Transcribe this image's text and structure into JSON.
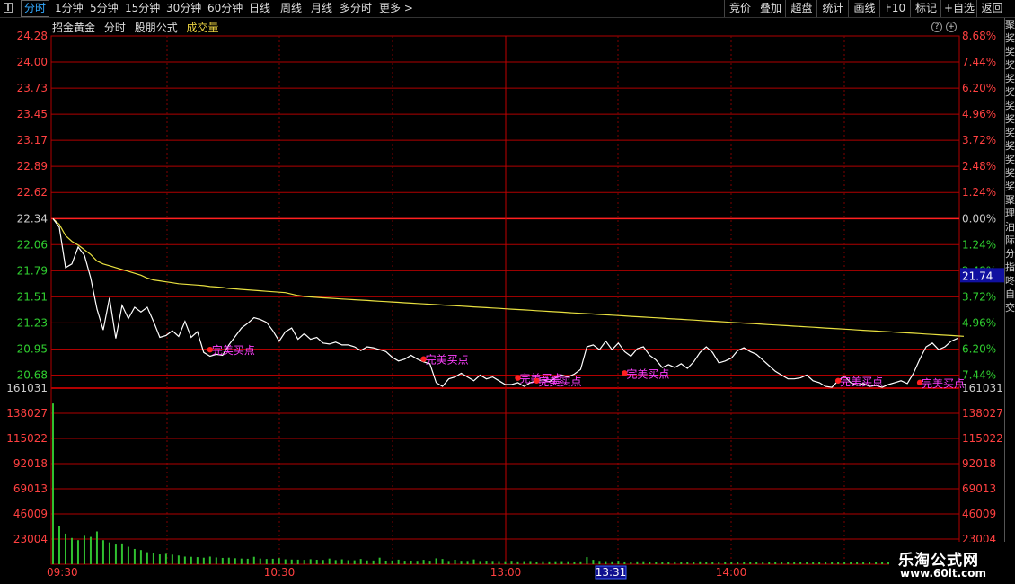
{
  "toolbar": {
    "periods": [
      "分时",
      "1分钟",
      "5分钟",
      "15分钟",
      "30分钟",
      "60分钟",
      "日线",
      "周线",
      "月线",
      "多分时",
      "更多"
    ],
    "active_index": 0,
    "right_buttons": [
      "竞价",
      "叠加",
      "超盘",
      "统计",
      "画线",
      "F10",
      "标记",
      "+自选",
      "返回"
    ]
  },
  "info": {
    "stock_name": "招金黄金",
    "mode": "分时",
    "formula": "股朋公式",
    "volume_label": "成交量"
  },
  "colors": {
    "price_line": "#ffffff",
    "avg_line": "#e8e040",
    "grid": "#b00000",
    "label_red": "#ff4040",
    "label_green": "#30d030",
    "signal": "#ff40ff",
    "volume_bar": "#30c030",
    "axis_time": "#ff4040"
  },
  "watermark": {
    "title": "乐淘公式网",
    "url": "www.60lt.com"
  },
  "side_text": "聚奖奖奖奖奖奖奖奖奖奖奖奖聚理泊际分指咚自交",
  "chart_data": {
    "type": "line",
    "price_axis": [
      "24.28",
      "24.00",
      "23.73",
      "23.45",
      "23.17",
      "22.89",
      "22.62",
      "22.34",
      "22.06",
      "21.79",
      "21.51",
      "21.23",
      "20.95",
      "20.68"
    ],
    "pct_axis": [
      "8.68%",
      "7.44%",
      "6.20%",
      "4.96%",
      "3.72%",
      "2.48%",
      "1.24%",
      "0.00%",
      "1.24%",
      "2.48%",
      "3.72%",
      "4.96%",
      "6.20%",
      "7.44%"
    ],
    "ylim": [
      20.55,
      24.28
    ],
    "prev_close": 22.34,
    "current_price_tag": "21.74",
    "volume_axis": [
      "161031",
      "138027",
      "115022",
      "92018",
      "69013",
      "46009",
      "23004"
    ],
    "volume_axis_right": [
      "161031",
      "138027",
      "115022",
      "92018",
      "69013",
      "46009",
      "23004"
    ],
    "volume_max": 161031,
    "time_labels": [
      "09:30",
      "10:30",
      "13:00",
      "14:00"
    ],
    "cursor_time": "13:31",
    "signal_label": "完美买点",
    "price": [
      22.34,
      22.25,
      21.82,
      21.86,
      22.04,
      21.95,
      21.71,
      21.38,
      21.16,
      21.5,
      21.07,
      21.42,
      21.28,
      21.4,
      21.35,
      21.4,
      21.25,
      21.08,
      21.1,
      21.15,
      21.09,
      21.25,
      21.08,
      21.14,
      20.92,
      20.88,
      20.9,
      20.89,
      21.0,
      21.09,
      21.18,
      21.23,
      21.29,
      21.27,
      21.24,
      21.15,
      21.04,
      21.14,
      21.18,
      21.06,
      21.12,
      21.06,
      21.08,
      21.02,
      21.01,
      21.03,
      21.0,
      21.0,
      20.98,
      20.94,
      20.98,
      20.97,
      20.95,
      20.93,
      20.87,
      20.83,
      20.85,
      20.89,
      20.85,
      20.82,
      20.8,
      20.6,
      20.56,
      20.64,
      20.66,
      20.7,
      20.66,
      20.62,
      20.68,
      20.64,
      20.66,
      20.62,
      20.58,
      20.58,
      20.6,
      20.56,
      20.6,
      20.62,
      20.63,
      20.61,
      20.65,
      20.68,
      20.66,
      20.69,
      20.74,
      20.98,
      21.0,
      20.95,
      21.04,
      20.95,
      21.02,
      20.93,
      20.88,
      20.96,
      20.98,
      20.89,
      20.84,
      20.76,
      20.79,
      20.76,
      20.8,
      20.75,
      20.82,
      20.92,
      20.98,
      20.92,
      20.81,
      20.83,
      20.86,
      20.94,
      20.97,
      20.93,
      20.9,
      20.84,
      20.78,
      20.72,
      20.68,
      20.64,
      20.64,
      20.65,
      20.68,
      20.62,
      20.6,
      20.56,
      20.55,
      20.62,
      20.67,
      20.6,
      20.57,
      20.59,
      20.56,
      20.57,
      20.55,
      20.58,
      20.6,
      20.62,
      20.59,
      20.7,
      20.85,
      20.98,
      21.02,
      20.95,
      20.98,
      21.04,
      21.07
    ],
    "avg": [
      22.34,
      22.28,
      22.16,
      22.1,
      22.06,
      22.01,
      21.96,
      21.89,
      21.86,
      21.84,
      21.82,
      21.8,
      21.78,
      21.76,
      21.74,
      21.71,
      21.69,
      21.68,
      21.67,
      21.66,
      21.65,
      21.645,
      21.64,
      21.635,
      21.63,
      21.62,
      21.615,
      21.61,
      21.6,
      21.595,
      21.59,
      21.585,
      21.58,
      21.575,
      21.57,
      21.565,
      21.56,
      21.555,
      21.54,
      21.525,
      21.515,
      21.51,
      21.505,
      21.5,
      21.496,
      21.492,
      21.488,
      21.484,
      21.48,
      21.476,
      21.472,
      21.468,
      21.464,
      21.46,
      21.456,
      21.452,
      21.448,
      21.444,
      21.44,
      21.436,
      21.432,
      21.428,
      21.424,
      21.42,
      21.416,
      21.412,
      21.408,
      21.404,
      21.4,
      21.396,
      21.392,
      21.388,
      21.384,
      21.38,
      21.376,
      21.372,
      21.368,
      21.364,
      21.36,
      21.356,
      21.352,
      21.348,
      21.344,
      21.34,
      21.336,
      21.332,
      21.328,
      21.324,
      21.32,
      21.316,
      21.312,
      21.308,
      21.304,
      21.3,
      21.296,
      21.292,
      21.288,
      21.284,
      21.28,
      21.276,
      21.272,
      21.268,
      21.264,
      21.26,
      21.256,
      21.252,
      21.248,
      21.244,
      21.24,
      21.236,
      21.232,
      21.228,
      21.224,
      21.22,
      21.216,
      21.212,
      21.208,
      21.204,
      21.2,
      21.196,
      21.192,
      21.188,
      21.184,
      21.18,
      21.176,
      21.172,
      21.168,
      21.164,
      21.16,
      21.156,
      21.152,
      21.148,
      21.144,
      21.14,
      21.136,
      21.132,
      21.128,
      21.124,
      21.12,
      21.116,
      21.112,
      21.108,
      21.104,
      21.1,
      21.096,
      21.092
    ],
    "volume": [
      147000,
      35000,
      28000,
      24000,
      22000,
      26000,
      25000,
      30000,
      22000,
      20000,
      18000,
      19000,
      16000,
      14000,
      13000,
      11000,
      10000,
      9000,
      9500,
      8800,
      8000,
      7000,
      6800,
      6500,
      6000,
      7000,
      6200,
      5800,
      6000,
      5500,
      5200,
      5000,
      6800,
      5200,
      4800,
      5000,
      5600,
      4500,
      4300,
      4200,
      4000,
      4600,
      4100,
      3900,
      5200,
      3800,
      4500,
      3700,
      3600,
      4800,
      3500,
      3400,
      6000,
      3300,
      3400,
      4200,
      3200,
      3300,
      3100,
      4000,
      3200,
      5400,
      4800,
      3000,
      4100,
      3100,
      3000,
      4400,
      2900,
      3200,
      3000,
      2800,
      2700,
      3100,
      2600,
      2800,
      2900,
      2500,
      2700,
      2600,
      2700,
      2800,
      2700,
      2500,
      2600,
      6500,
      4000,
      3000,
      2800,
      2600,
      3200,
      2500,
      2400,
      2600,
      2700,
      2500,
      2300,
      2400,
      2200,
      2500,
      2300,
      2200,
      2300,
      2600,
      2400,
      2300,
      2200,
      2100,
      2300,
      2200,
      2100,
      2000,
      2200,
      2100,
      2000,
      1900,
      2100,
      2000,
      2200,
      1900,
      2000,
      1900,
      2000,
      1900,
      1800,
      2100,
      1900,
      1800,
      2000,
      1900,
      1800,
      1900,
      1700,
      1800,
      1900,
      2000,
      1800,
      2200,
      2400,
      2500,
      2300,
      2200,
      2100,
      2300
    ],
    "signals": [
      {
        "index": 25,
        "price": 20.95
      },
      {
        "index": 59,
        "price": 20.85
      },
      {
        "index": 74,
        "price": 20.65
      },
      {
        "index": 77,
        "price": 20.62
      },
      {
        "index": 91,
        "price": 20.7
      },
      {
        "index": 125,
        "price": 20.62
      },
      {
        "index": 138,
        "price": 20.6
      }
    ]
  }
}
